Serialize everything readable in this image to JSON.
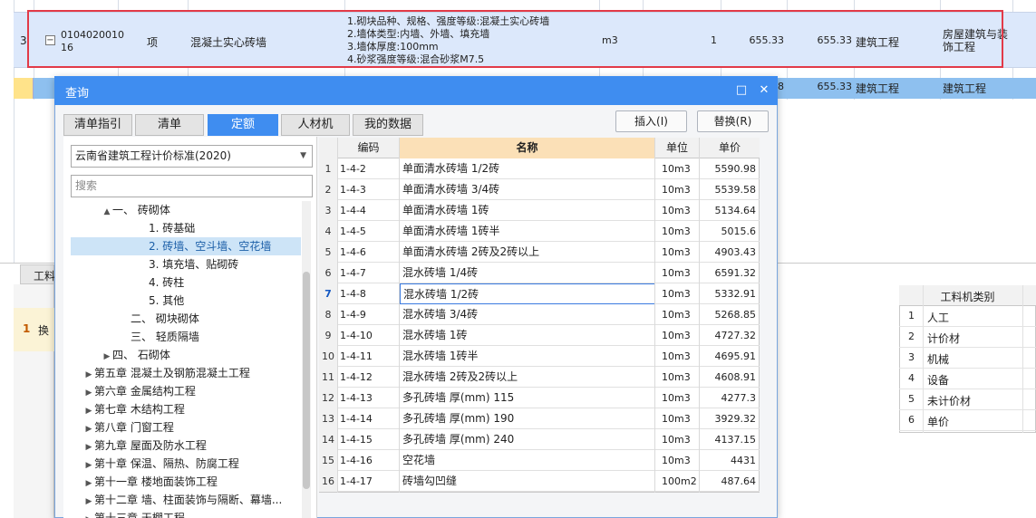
{
  "background_sheet": {
    "row3": {
      "index": "3",
      "code": "0104020010\n16",
      "code_line1": "0104020010",
      "code_line2": "16",
      "type": "项",
      "name": "混凝土实心砖墙",
      "description": [
        "1.砌块品种、规格、强度等级:混凝土实心砖墙",
        "2.墙体类型:内墙、外墙、填充墙",
        "3.墙体厚度:100mm",
        "4.砂浆强度等级:混合砂浆M7.5"
      ],
      "unit": "m3",
      "quantity": "1",
      "price": "655.33",
      "total": "655.33",
      "specialty": "建筑工程",
      "category": "房屋建筑与装饰工程"
    },
    "row4": {
      "price_tail": "8",
      "total": "655.33",
      "specialty": "建筑工程",
      "category": "建筑工程"
    },
    "lower_tab_label": "工料",
    "lower_row_index": "1",
    "lower_row_text": "换",
    "category_table": {
      "header": "工料机类别",
      "rows": [
        {
          "index": "1",
          "label": "人工"
        },
        {
          "index": "2",
          "label": "计价材"
        },
        {
          "index": "3",
          "label": "机械"
        },
        {
          "index": "4",
          "label": "设备"
        },
        {
          "index": "5",
          "label": "未计价材"
        },
        {
          "index": "6",
          "label": "单价"
        }
      ]
    }
  },
  "dialog": {
    "title": "查询",
    "maximize_glyph": "□",
    "close_glyph": "✕",
    "tabs": [
      {
        "label": "清单指引",
        "active": false
      },
      {
        "label": "清单",
        "active": false
      },
      {
        "label": "定额",
        "active": true
      },
      {
        "label": "人材机",
        "active": false
      },
      {
        "label": "我的数据",
        "active": false
      }
    ],
    "insert_button": "插入(I)",
    "replace_button": "替换(R)",
    "standard_select": "云南省建筑工程计价标准(2020)",
    "search_placeholder": "搜索",
    "tree": [
      {
        "label": "一、 砖砌体",
        "indent": 2,
        "arrow": "▲",
        "selected": false
      },
      {
        "label": "1. 砖基础",
        "indent": 4,
        "arrow": "",
        "selected": false
      },
      {
        "label": "2. 砖墙、空斗墙、空花墙",
        "indent": 4,
        "arrow": "",
        "selected": true
      },
      {
        "label": "3. 填充墙、贴砌砖",
        "indent": 4,
        "arrow": "",
        "selected": false
      },
      {
        "label": "4. 砖柱",
        "indent": 4,
        "arrow": "",
        "selected": false
      },
      {
        "label": "5. 其他",
        "indent": 4,
        "arrow": "",
        "selected": false
      },
      {
        "label": "二、 砌块砌体",
        "indent": 3,
        "arrow": "",
        "selected": false
      },
      {
        "label": "三、 轻质隔墙",
        "indent": 3,
        "arrow": "",
        "selected": false
      },
      {
        "label": "四、 石砌体",
        "indent": 2,
        "arrow": "▶",
        "selected": false
      },
      {
        "label": "第五章 混凝土及钢筋混凝土工程",
        "indent": 1,
        "arrow": "▶",
        "selected": false
      },
      {
        "label": "第六章 金属结构工程",
        "indent": 1,
        "arrow": "▶",
        "selected": false
      },
      {
        "label": "第七章 木结构工程",
        "indent": 1,
        "arrow": "▶",
        "selected": false
      },
      {
        "label": "第八章 门窗工程",
        "indent": 1,
        "arrow": "▶",
        "selected": false
      },
      {
        "label": "第九章 屋面及防水工程",
        "indent": 1,
        "arrow": "▶",
        "selected": false
      },
      {
        "label": "第十章 保温、隔热、防腐工程",
        "indent": 1,
        "arrow": "▶",
        "selected": false
      },
      {
        "label": "第十一章 楼地面装饰工程",
        "indent": 1,
        "arrow": "▶",
        "selected": false
      },
      {
        "label": "第十二章 墙、柱面装饰与隔断、幕墙...",
        "indent": 1,
        "arrow": "▶",
        "selected": false
      },
      {
        "label": "第十三章 天棚工程",
        "indent": 1,
        "arrow": "▶",
        "selected": false
      }
    ],
    "table": {
      "columns": {
        "code": "编码",
        "name": "名称",
        "unit": "单位",
        "price": "单价"
      },
      "selected_row": "7",
      "rows": [
        {
          "n": "1",
          "code": "1-4-2",
          "name": "单面清水砖墙 1/2砖",
          "unit": "10m3",
          "price": "5590.98"
        },
        {
          "n": "2",
          "code": "1-4-3",
          "name": "单面清水砖墙 3/4砖",
          "unit": "10m3",
          "price": "5539.58"
        },
        {
          "n": "3",
          "code": "1-4-4",
          "name": "单面清水砖墙 1砖",
          "unit": "10m3",
          "price": "5134.64"
        },
        {
          "n": "4",
          "code": "1-4-5",
          "name": "单面清水砖墙 1砖半",
          "unit": "10m3",
          "price": "5015.6"
        },
        {
          "n": "5",
          "code": "1-4-6",
          "name": "单面清水砖墙 2砖及2砖以上",
          "unit": "10m3",
          "price": "4903.43"
        },
        {
          "n": "6",
          "code": "1-4-7",
          "name": "混水砖墙 1/4砖",
          "unit": "10m3",
          "price": "6591.32"
        },
        {
          "n": "7",
          "code": "1-4-8",
          "name": "混水砖墙 1/2砖",
          "unit": "10m3",
          "price": "5332.91"
        },
        {
          "n": "8",
          "code": "1-4-9",
          "name": "混水砖墙 3/4砖",
          "unit": "10m3",
          "price": "5268.85"
        },
        {
          "n": "9",
          "code": "1-4-10",
          "name": "混水砖墙 1砖",
          "unit": "10m3",
          "price": "4727.32"
        },
        {
          "n": "10",
          "code": "1-4-11",
          "name": "混水砖墙 1砖半",
          "unit": "10m3",
          "price": "4695.91"
        },
        {
          "n": "11",
          "code": "1-4-12",
          "name": "混水砖墙 2砖及2砖以上",
          "unit": "10m3",
          "price": "4608.91"
        },
        {
          "n": "12",
          "code": "1-4-13",
          "name": "多孔砖墙 厚(mm) 115",
          "unit": "10m3",
          "price": "4277.3"
        },
        {
          "n": "13",
          "code": "1-4-14",
          "name": "多孔砖墙 厚(mm) 190",
          "unit": "10m3",
          "price": "3929.32"
        },
        {
          "n": "14",
          "code": "1-4-15",
          "name": "多孔砖墙 厚(mm) 240",
          "unit": "10m3",
          "price": "4137.15"
        },
        {
          "n": "15",
          "code": "1-4-16",
          "name": "空花墙",
          "unit": "10m3",
          "price": "4431"
        },
        {
          "n": "16",
          "code": "1-4-17",
          "name": "砖墙勾凹缝",
          "unit": "100m2",
          "price": "487.64"
        }
      ]
    }
  }
}
